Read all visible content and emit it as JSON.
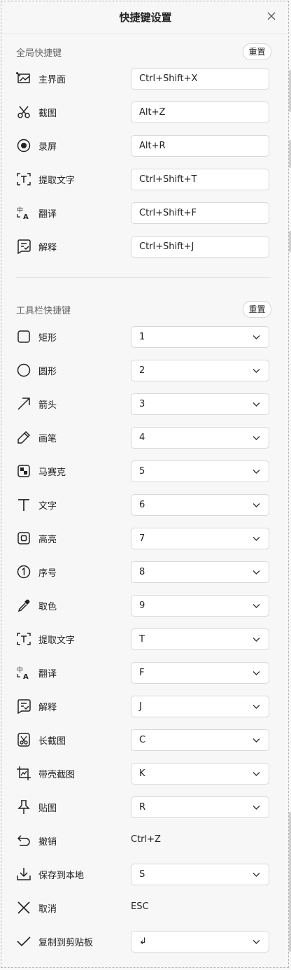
{
  "window": {
    "title": "快捷键设置"
  },
  "global": {
    "title": "全局快捷键",
    "reset_label": "重置",
    "items": [
      {
        "icon": "main-window-icon",
        "label": "主界面",
        "value": "Ctrl+Shift+X"
      },
      {
        "icon": "scissors-icon",
        "label": "截图",
        "value": "Alt+Z"
      },
      {
        "icon": "record-icon",
        "label": "录屏",
        "value": "Alt+R"
      },
      {
        "icon": "text-extract-icon",
        "label": "提取文字",
        "value": "Ctrl+Shift+T"
      },
      {
        "icon": "translate-icon",
        "label": "翻译",
        "value": "Ctrl+Shift+F"
      },
      {
        "icon": "explain-icon",
        "label": "解释",
        "value": "Ctrl+Shift+J"
      }
    ]
  },
  "toolbar": {
    "title": "工具栏快捷键",
    "reset_label": "重置",
    "items": [
      {
        "icon": "rectangle-icon",
        "label": "矩形",
        "value": "1"
      },
      {
        "icon": "circle-icon",
        "label": "圆形",
        "value": "2"
      },
      {
        "icon": "arrow-icon",
        "label": "箭头",
        "value": "3"
      },
      {
        "icon": "pen-icon",
        "label": "画笔",
        "value": "4"
      },
      {
        "icon": "mosaic-icon",
        "label": "马赛克",
        "value": "5"
      },
      {
        "icon": "text-icon",
        "label": "文字",
        "value": "6"
      },
      {
        "icon": "highlight-icon",
        "label": "高亮",
        "value": "7"
      },
      {
        "icon": "number-icon",
        "label": "序号",
        "value": "8"
      },
      {
        "icon": "color-picker-icon",
        "label": "取色",
        "value": "9"
      },
      {
        "icon": "text-extract-icon",
        "label": "提取文字",
        "value": "T"
      },
      {
        "icon": "translate-icon",
        "label": "翻译",
        "value": "F"
      },
      {
        "icon": "explain-icon",
        "label": "解释",
        "value": "J"
      },
      {
        "icon": "long-screenshot-icon",
        "label": "长截图",
        "value": "C"
      },
      {
        "icon": "frame-screenshot-icon",
        "label": "带壳截图",
        "value": "K"
      },
      {
        "icon": "pin-icon",
        "label": "贴图",
        "value": "R"
      },
      {
        "icon": "undo-icon",
        "label": "撤销",
        "value": "Ctrl+Z"
      },
      {
        "icon": "download-icon",
        "label": "保存到本地",
        "value": "S"
      },
      {
        "icon": "cancel-icon",
        "label": "取消",
        "value": "ESC"
      },
      {
        "icon": "check-icon",
        "label": "复制到剪贴板",
        "value": "↲"
      }
    ]
  },
  "colors": {
    "background": "#f7f7f7",
    "border": "#d8d8d8",
    "text": "#222222",
    "section_text": "#666666"
  }
}
